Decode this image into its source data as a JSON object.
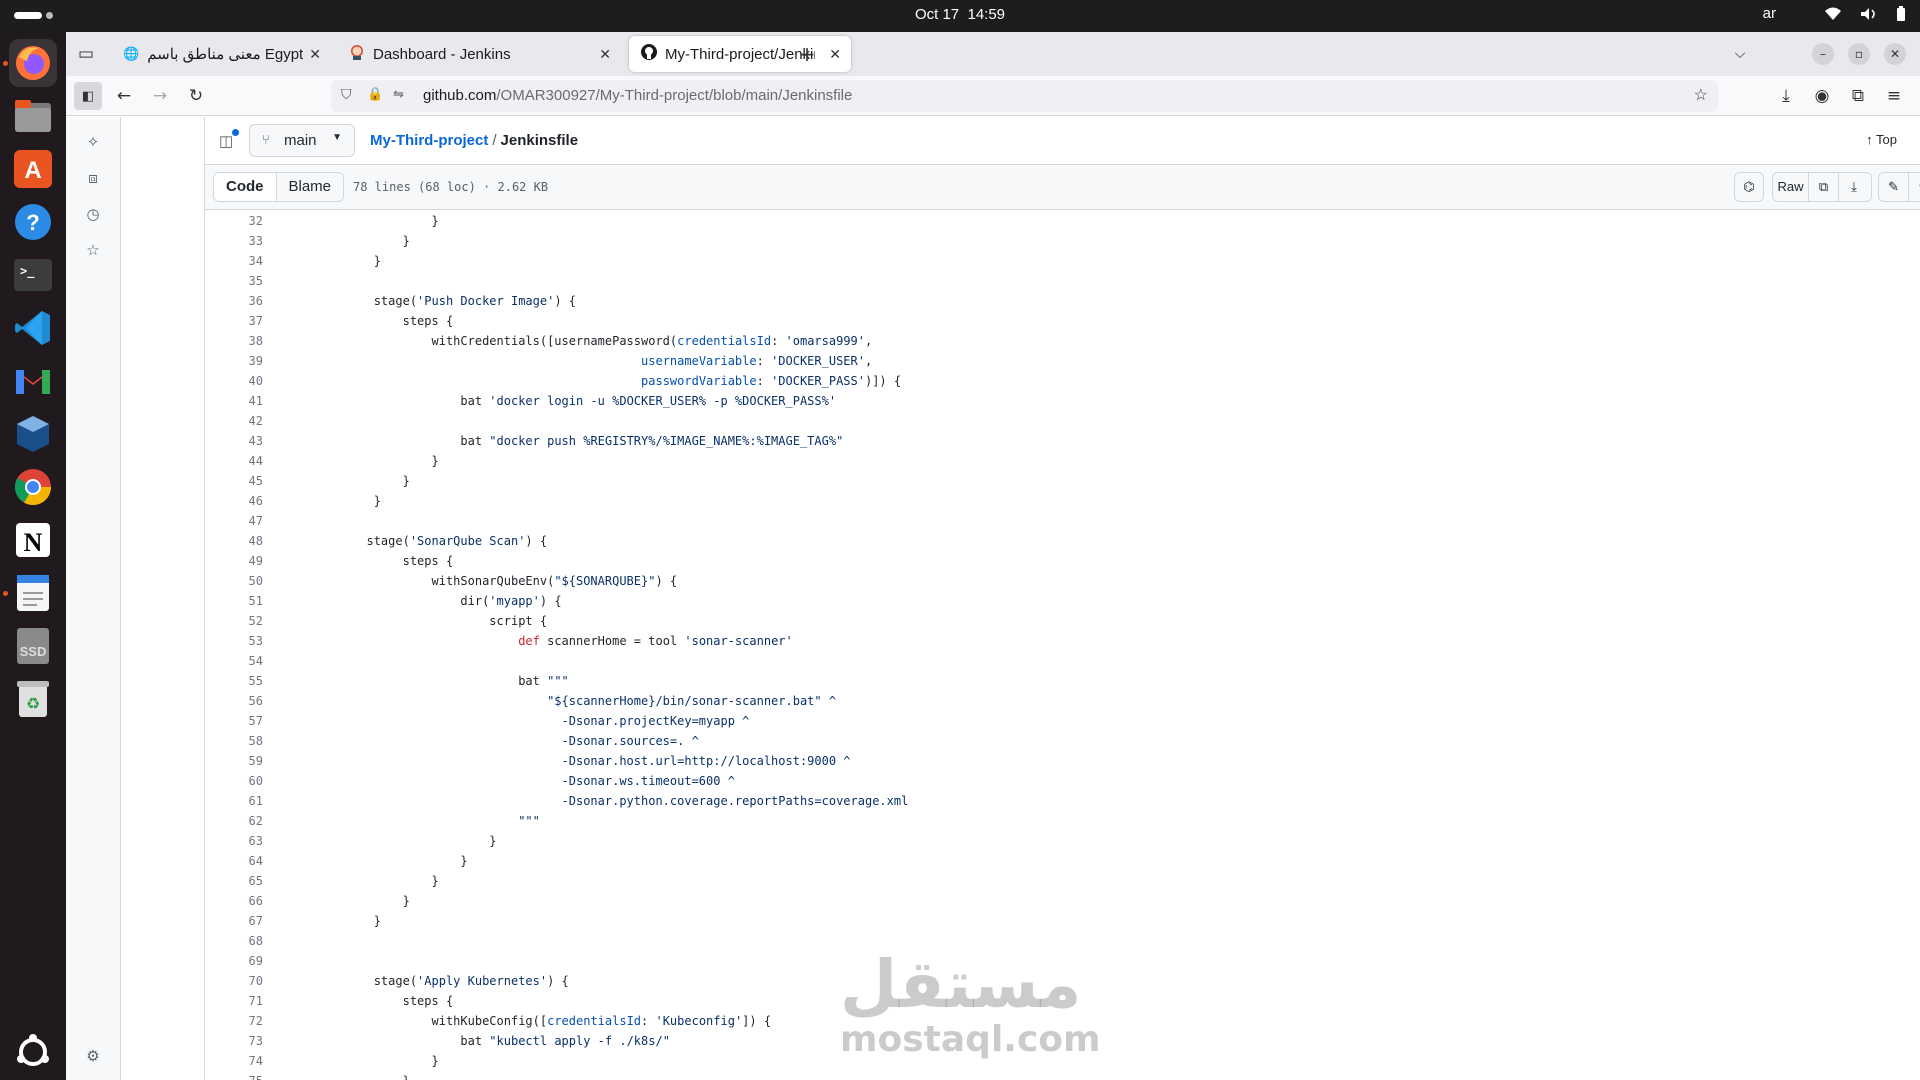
{
  "system": {
    "date": "Oct 17",
    "time": "14:59",
    "lang": "ar"
  },
  "dock": [
    "firefox",
    "files",
    "app-center",
    "help",
    "terminal",
    "vscode",
    "gmail",
    "virtualbox",
    "chrome",
    "notion",
    "text-editor",
    "ssd",
    "trash",
    "show-apps"
  ],
  "browser": {
    "tabs": [
      {
        "label": "معنى مناطق باسم Egypt",
        "icon": "globe-icon"
      },
      {
        "label": "Dashboard - Jenkins",
        "icon": "jenkins-icon"
      },
      {
        "label": "My-Third-project/Jenkinsf",
        "icon": "github-icon"
      }
    ],
    "url_domain": "github.com",
    "url_path": "/OMAR300927/My-Third-project/blob/main/Jenkinsfile"
  },
  "repo": {
    "branch": "main",
    "name": "My-Third-project",
    "file": "Jenkinsfile",
    "sep": "/",
    "top_label": "Top"
  },
  "filebar": {
    "code_tab": "Code",
    "blame_tab": "Blame",
    "info": "78 lines (68 loc) · 2.62 KB",
    "raw_label": "Raw"
  },
  "code_lines": [
    {
      "n": "32",
      "t": [
        [
          "                    }",
          ""
        ]
      ]
    },
    {
      "n": "33",
      "t": [
        [
          "                }",
          ""
        ]
      ]
    },
    {
      "n": "34",
      "t": [
        [
          "            }",
          ""
        ]
      ]
    },
    {
      "n": "35",
      "t": [
        [
          "",
          ""
        ]
      ]
    },
    {
      "n": "36",
      "t": [
        [
          "            stage(",
          ""
        ],
        [
          "'Push Docker Image'",
          "st"
        ],
        [
          ") {",
          ""
        ]
      ]
    },
    {
      "n": "37",
      "t": [
        [
          "                steps {",
          ""
        ]
      ]
    },
    {
      "n": "38",
      "t": [
        [
          "                    withCredentials([usernamePassword(",
          ""
        ],
        [
          "credentialsId",
          "nm"
        ],
        [
          ": ",
          ""
        ],
        [
          "'omarsa999'",
          "st"
        ],
        [
          ",",
          ""
        ]
      ]
    },
    {
      "n": "39",
      "t": [
        [
          "                                                 ",
          ""
        ],
        [
          "usernameVariable",
          "nm"
        ],
        [
          ": ",
          ""
        ],
        [
          "'DOCKER_USER'",
          "st"
        ],
        [
          ",",
          ""
        ]
      ]
    },
    {
      "n": "40",
      "t": [
        [
          "                                                 ",
          ""
        ],
        [
          "passwordVariable",
          "nm"
        ],
        [
          ": ",
          ""
        ],
        [
          "'DOCKER_PASS'",
          "st"
        ],
        [
          ")]) {",
          ""
        ]
      ]
    },
    {
      "n": "41",
      "t": [
        [
          "                        bat ",
          ""
        ],
        [
          "'docker login -u %DOCKER_USER% -p %DOCKER_PASS%'",
          "st"
        ]
      ]
    },
    {
      "n": "42",
      "t": [
        [
          "",
          ""
        ]
      ]
    },
    {
      "n": "43",
      "t": [
        [
          "                        bat ",
          ""
        ],
        [
          "\"docker push %REGISTRY%/%IMAGE_NAME%:%IMAGE_TAG%\"",
          "st"
        ]
      ]
    },
    {
      "n": "44",
      "t": [
        [
          "                    }",
          ""
        ]
      ]
    },
    {
      "n": "45",
      "t": [
        [
          "                }",
          ""
        ]
      ]
    },
    {
      "n": "46",
      "t": [
        [
          "            }",
          ""
        ]
      ]
    },
    {
      "n": "47",
      "t": [
        [
          "",
          ""
        ]
      ]
    },
    {
      "n": "48",
      "t": [
        [
          "           stage(",
          ""
        ],
        [
          "'SonarQube Scan'",
          "st"
        ],
        [
          ") {",
          ""
        ]
      ]
    },
    {
      "n": "49",
      "t": [
        [
          "                steps {",
          ""
        ]
      ]
    },
    {
      "n": "50",
      "t": [
        [
          "                    withSonarQubeEnv(",
          ""
        ],
        [
          "\"${SONARQUBE}\"",
          "st"
        ],
        [
          ") {",
          ""
        ]
      ]
    },
    {
      "n": "51",
      "t": [
        [
          "                        dir(",
          ""
        ],
        [
          "'myapp'",
          "st"
        ],
        [
          ") {",
          ""
        ]
      ]
    },
    {
      "n": "52",
      "t": [
        [
          "                            script {",
          ""
        ]
      ]
    },
    {
      "n": "53",
      "t": [
        [
          "                                ",
          ""
        ],
        [
          "def",
          "kw"
        ],
        [
          " scannerHome = tool ",
          ""
        ],
        [
          "'sonar-scanner'",
          "st"
        ]
      ]
    },
    {
      "n": "54",
      "t": [
        [
          "",
          ""
        ]
      ]
    },
    {
      "n": "55",
      "t": [
        [
          "                                bat ",
          ""
        ],
        [
          "\"\"\"",
          "st"
        ]
      ]
    },
    {
      "n": "56",
      "t": [
        [
          "                                    \"${scannerHome}/bin/sonar-scanner.bat\" ^",
          "st"
        ]
      ]
    },
    {
      "n": "57",
      "t": [
        [
          "                                      -Dsonar.projectKey=myapp ^",
          "st"
        ]
      ]
    },
    {
      "n": "58",
      "t": [
        [
          "                                      -Dsonar.sources=. ^",
          "st"
        ]
      ]
    },
    {
      "n": "59",
      "t": [
        [
          "                                      -Dsonar.host.url=http://localhost:9000 ^",
          "st"
        ]
      ]
    },
    {
      "n": "60",
      "t": [
        [
          "                                      -Dsonar.ws.timeout=600 ^",
          "st"
        ]
      ]
    },
    {
      "n": "61",
      "t": [
        [
          "                                      -Dsonar.python.coverage.reportPaths=coverage.xml",
          "st"
        ]
      ]
    },
    {
      "n": "62",
      "t": [
        [
          "                                \"\"\"",
          "st"
        ]
      ]
    },
    {
      "n": "63",
      "t": [
        [
          "                            }",
          ""
        ]
      ]
    },
    {
      "n": "64",
      "t": [
        [
          "                        }",
          ""
        ]
      ]
    },
    {
      "n": "65",
      "t": [
        [
          "                    }",
          ""
        ]
      ]
    },
    {
      "n": "66",
      "t": [
        [
          "                }",
          ""
        ]
      ]
    },
    {
      "n": "67",
      "t": [
        [
          "            }",
          ""
        ]
      ]
    },
    {
      "n": "68",
      "t": [
        [
          "",
          ""
        ]
      ]
    },
    {
      "n": "69",
      "t": [
        [
          "",
          ""
        ]
      ]
    },
    {
      "n": "70",
      "t": [
        [
          "            stage(",
          ""
        ],
        [
          "'Apply Kubernetes'",
          "st"
        ],
        [
          ") {",
          ""
        ]
      ]
    },
    {
      "n": "71",
      "t": [
        [
          "                steps {",
          ""
        ]
      ]
    },
    {
      "n": "72",
      "t": [
        [
          "                    withKubeConfig([",
          ""
        ],
        [
          "credentialsId",
          "nm"
        ],
        [
          ": ",
          ""
        ],
        [
          "'Kubeconfig'",
          "st"
        ],
        [
          "]) {",
          ""
        ]
      ]
    },
    {
      "n": "73",
      "t": [
        [
          "                        bat ",
          ""
        ],
        [
          "\"kubectl apply -f ./k8s/\"",
          "st"
        ]
      ]
    },
    {
      "n": "74",
      "t": [
        [
          "                    }",
          ""
        ]
      ]
    },
    {
      "n": "75",
      "t": [
        [
          "                }",
          ""
        ]
      ]
    }
  ],
  "watermark": {
    "ar": "مستقل",
    "en": "mostaql.com"
  }
}
